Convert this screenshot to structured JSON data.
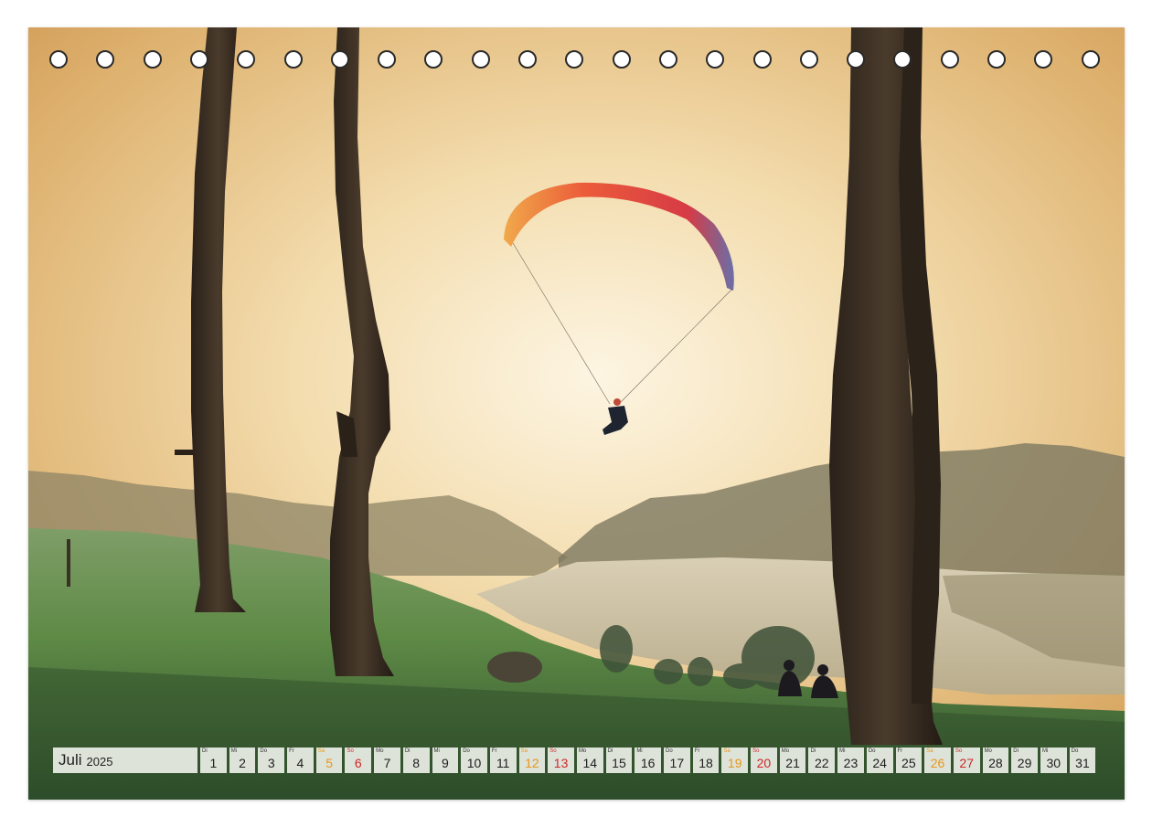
{
  "calendar": {
    "month": "Juli",
    "year": "2025",
    "days": [
      {
        "wd": "Di",
        "d": "1",
        "type": "weekday"
      },
      {
        "wd": "Mi",
        "d": "2",
        "type": "weekday"
      },
      {
        "wd": "Do",
        "d": "3",
        "type": "weekday"
      },
      {
        "wd": "Fr",
        "d": "4",
        "type": "weekday"
      },
      {
        "wd": "Sa",
        "d": "5",
        "type": "sat"
      },
      {
        "wd": "So",
        "d": "6",
        "type": "sun"
      },
      {
        "wd": "Mo",
        "d": "7",
        "type": "weekday"
      },
      {
        "wd": "Di",
        "d": "8",
        "type": "weekday"
      },
      {
        "wd": "Mi",
        "d": "9",
        "type": "weekday"
      },
      {
        "wd": "Do",
        "d": "10",
        "type": "weekday"
      },
      {
        "wd": "Fr",
        "d": "11",
        "type": "weekday"
      },
      {
        "wd": "Sa",
        "d": "12",
        "type": "sat"
      },
      {
        "wd": "So",
        "d": "13",
        "type": "sun"
      },
      {
        "wd": "Mo",
        "d": "14",
        "type": "weekday"
      },
      {
        "wd": "Di",
        "d": "15",
        "type": "weekday"
      },
      {
        "wd": "Mi",
        "d": "16",
        "type": "weekday"
      },
      {
        "wd": "Do",
        "d": "17",
        "type": "weekday"
      },
      {
        "wd": "Fr",
        "d": "18",
        "type": "weekday"
      },
      {
        "wd": "Sa",
        "d": "19",
        "type": "sat"
      },
      {
        "wd": "So",
        "d": "20",
        "type": "sun"
      },
      {
        "wd": "Mo",
        "d": "21",
        "type": "weekday"
      },
      {
        "wd": "Di",
        "d": "22",
        "type": "weekday"
      },
      {
        "wd": "Mi",
        "d": "23",
        "type": "weekday"
      },
      {
        "wd": "Do",
        "d": "24",
        "type": "weekday"
      },
      {
        "wd": "Fr",
        "d": "25",
        "type": "weekday"
      },
      {
        "wd": "Sa",
        "d": "26",
        "type": "sat"
      },
      {
        "wd": "So",
        "d": "27",
        "type": "sun"
      },
      {
        "wd": "Mo",
        "d": "28",
        "type": "weekday"
      },
      {
        "wd": "Di",
        "d": "29",
        "type": "weekday"
      },
      {
        "wd": "Mi",
        "d": "30",
        "type": "weekday"
      },
      {
        "wd": "Do",
        "d": "31",
        "type": "weekday"
      }
    ]
  },
  "colors": {
    "saturday": "#e8961e",
    "sunday": "#d0262a",
    "sky_top": "#d9a45c",
    "sky_glow": "#fbf1d8",
    "grass": "#4f7a3c",
    "canopy": "#e8503a"
  },
  "icons": {
    "binding_rings": "binding-ring",
    "photo": "paraglider-landscape"
  }
}
